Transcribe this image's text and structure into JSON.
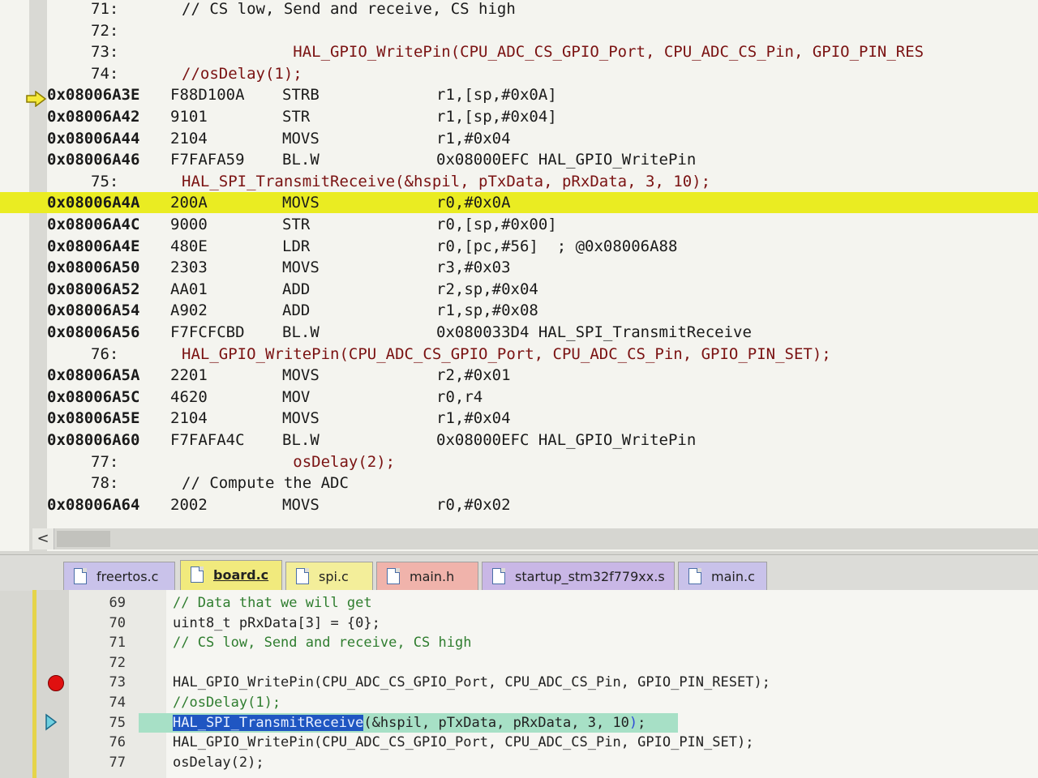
{
  "disassembly": {
    "lines": [
      {
        "kind": "src",
        "num": "71:",
        "code": "// CS low, Send and receive, CS high",
        "cmt": true
      },
      {
        "kind": "src",
        "num": "72:",
        "code": ""
      },
      {
        "kind": "src",
        "num": "73:",
        "code": "            HAL_GPIO_WritePin(CPU_ADC_CS_GPIO_Port, CPU_ADC_CS_Pin, GPIO_PIN_RES"
      },
      {
        "kind": "src",
        "num": "74:",
        "code": "//osDelay(1);"
      },
      {
        "kind": "asm",
        "addr": "0x08006A3E",
        "opcode": "F88D100A",
        "mnemonic": "STRB",
        "operands": "r1,[sp,#0x0A]"
      },
      {
        "kind": "asm",
        "addr": "0x08006A42",
        "opcode": "9101",
        "mnemonic": "STR",
        "operands": "r1,[sp,#0x04]"
      },
      {
        "kind": "asm",
        "addr": "0x08006A44",
        "opcode": "2104",
        "mnemonic": "MOVS",
        "operands": "r1,#0x04"
      },
      {
        "kind": "asm",
        "addr": "0x08006A46",
        "opcode": "F7FAFA59",
        "mnemonic": "BL.W",
        "operands": "0x08000EFC HAL_GPIO_WritePin"
      },
      {
        "kind": "src",
        "num": "75:",
        "code": "HAL_SPI_TransmitReceive(&hspil, pTxData, pRxData, 3, 10);"
      },
      {
        "kind": "asm",
        "addr": "0x08006A4A",
        "opcode": "200A",
        "mnemonic": "MOVS",
        "operands": "r0,#0x0A",
        "highlight": true
      },
      {
        "kind": "asm",
        "addr": "0x08006A4C",
        "opcode": "9000",
        "mnemonic": "STR",
        "operands": "r0,[sp,#0x00]"
      },
      {
        "kind": "asm",
        "addr": "0x08006A4E",
        "opcode": "480E",
        "mnemonic": "LDR",
        "operands": "r0,[pc,#56]  ; @0x08006A88"
      },
      {
        "kind": "asm",
        "addr": "0x08006A50",
        "opcode": "2303",
        "mnemonic": "MOVS",
        "operands": "r3,#0x03"
      },
      {
        "kind": "asm",
        "addr": "0x08006A52",
        "opcode": "AA01",
        "mnemonic": "ADD",
        "operands": "r2,sp,#0x04"
      },
      {
        "kind": "asm",
        "addr": "0x08006A54",
        "opcode": "A902",
        "mnemonic": "ADD",
        "operands": "r1,sp,#0x08"
      },
      {
        "kind": "asm",
        "addr": "0x08006A56",
        "opcode": "F7FCFCBD",
        "mnemonic": "BL.W",
        "operands": "0x080033D4 HAL_SPI_TransmitReceive"
      },
      {
        "kind": "src",
        "num": "76:",
        "code": "HAL_GPIO_WritePin(CPU_ADC_CS_GPIO_Port, CPU_ADC_CS_Pin, GPIO_PIN_SET);"
      },
      {
        "kind": "asm",
        "addr": "0x08006A5A",
        "opcode": "2201",
        "mnemonic": "MOVS",
        "operands": "r2,#0x01"
      },
      {
        "kind": "asm",
        "addr": "0x08006A5C",
        "opcode": "4620",
        "mnemonic": "MOV",
        "operands": "r0,r4"
      },
      {
        "kind": "asm",
        "addr": "0x08006A5E",
        "opcode": "2104",
        "mnemonic": "MOVS",
        "operands": "r1,#0x04"
      },
      {
        "kind": "asm",
        "addr": "0x08006A60",
        "opcode": "F7FAFA4C",
        "mnemonic": "BL.W",
        "operands": "0x08000EFC HAL_GPIO_WritePin"
      },
      {
        "kind": "src",
        "num": "77:",
        "code": "            osDelay(2);"
      },
      {
        "kind": "src",
        "num": "78:",
        "code": "// Compute the ADC",
        "cmt": true
      },
      {
        "kind": "asm",
        "addr": "0x08006A64",
        "opcode": "2002",
        "mnemonic": "MOVS",
        "operands": "r0,#0x02"
      }
    ],
    "scroll_left_label": "<",
    "current_pc_marker": "arrow-right-icon"
  },
  "tabs": [
    {
      "label": "freertos.c",
      "color": "#c9c2ea"
    },
    {
      "label": "board.c",
      "color": "#f1ea7d",
      "active": true
    },
    {
      "label": "spi.c",
      "color": "#f3ee9a"
    },
    {
      "label": "main.h",
      "color": "#f0b3ab"
    },
    {
      "label": "startup_stm32f779xx.s",
      "color": "#c9b7e6"
    },
    {
      "label": "main.c",
      "color": "#c9c2ea"
    }
  ],
  "editor": {
    "lines": [
      {
        "num": "69",
        "code": "// Data that we will get",
        "cmt": true
      },
      {
        "num": "70",
        "code": "uint8_t pRxData[3] = {0};"
      },
      {
        "num": "71",
        "code": "// CS low, Send and receive, CS high",
        "cmt": true
      },
      {
        "num": "72",
        "code": ""
      },
      {
        "num": "73",
        "code": "HAL_GPIO_WritePin(CPU_ADC_CS_GPIO_Port, CPU_ADC_CS_Pin, GPIO_PIN_RESET);",
        "breakpoint": true
      },
      {
        "num": "74",
        "code": "//osDelay(1);",
        "cmt": true
      },
      {
        "num": "75",
        "sel": "HAL_SPI_TransmitReceive",
        "rest": "(&hspil, pTxData, pRxData, 3, 10",
        "brk": ")",
        "tail": ";",
        "current": true
      },
      {
        "num": "76",
        "code": "HAL_GPIO_WritePin(CPU_ADC_CS_GPIO_Port, CPU_ADC_CS_Pin, GPIO_PIN_SET);"
      },
      {
        "num": "77",
        "code": "osDelay(2);"
      }
    ]
  },
  "colors": {
    "highlight_line": "#eaec22",
    "current_line": "#a7e0c6",
    "breakpoint": "#e01010",
    "source_text": "#7a1212"
  }
}
